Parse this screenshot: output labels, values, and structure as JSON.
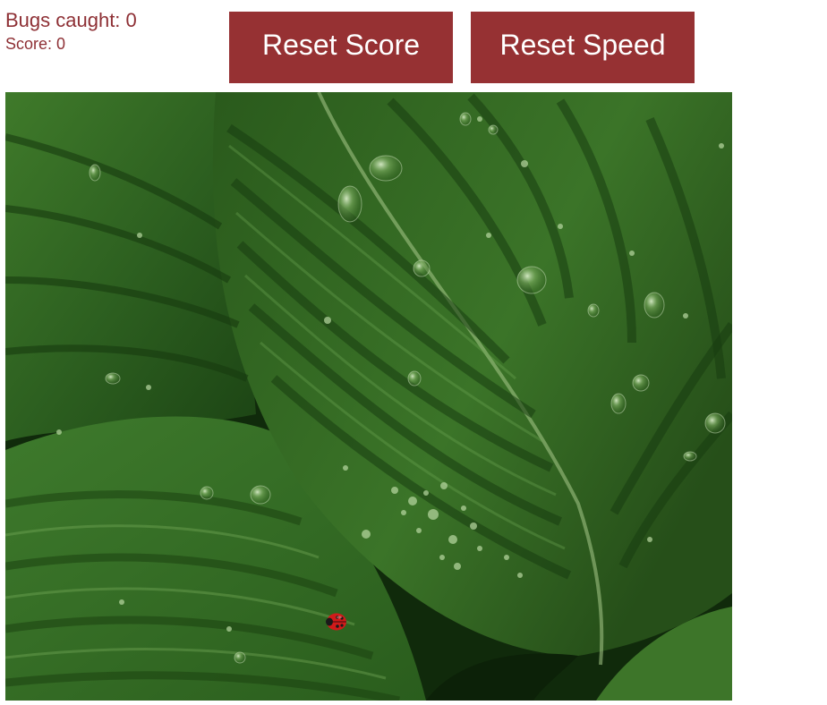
{
  "hud": {
    "bugs_caught_label": "Bugs caught: 0",
    "score_label": "Score: 0",
    "bugs_caught": 0,
    "score": 0
  },
  "buttons": {
    "reset_score": "Reset Score",
    "reset_speed": "Reset Speed"
  },
  "game": {
    "background": "green leaves with water droplets",
    "target": "ladybug",
    "colors": {
      "text": "#8e3035",
      "button_bg": "#963133",
      "button_text": "#ffffff",
      "bug_red": "#d11a1a"
    }
  }
}
